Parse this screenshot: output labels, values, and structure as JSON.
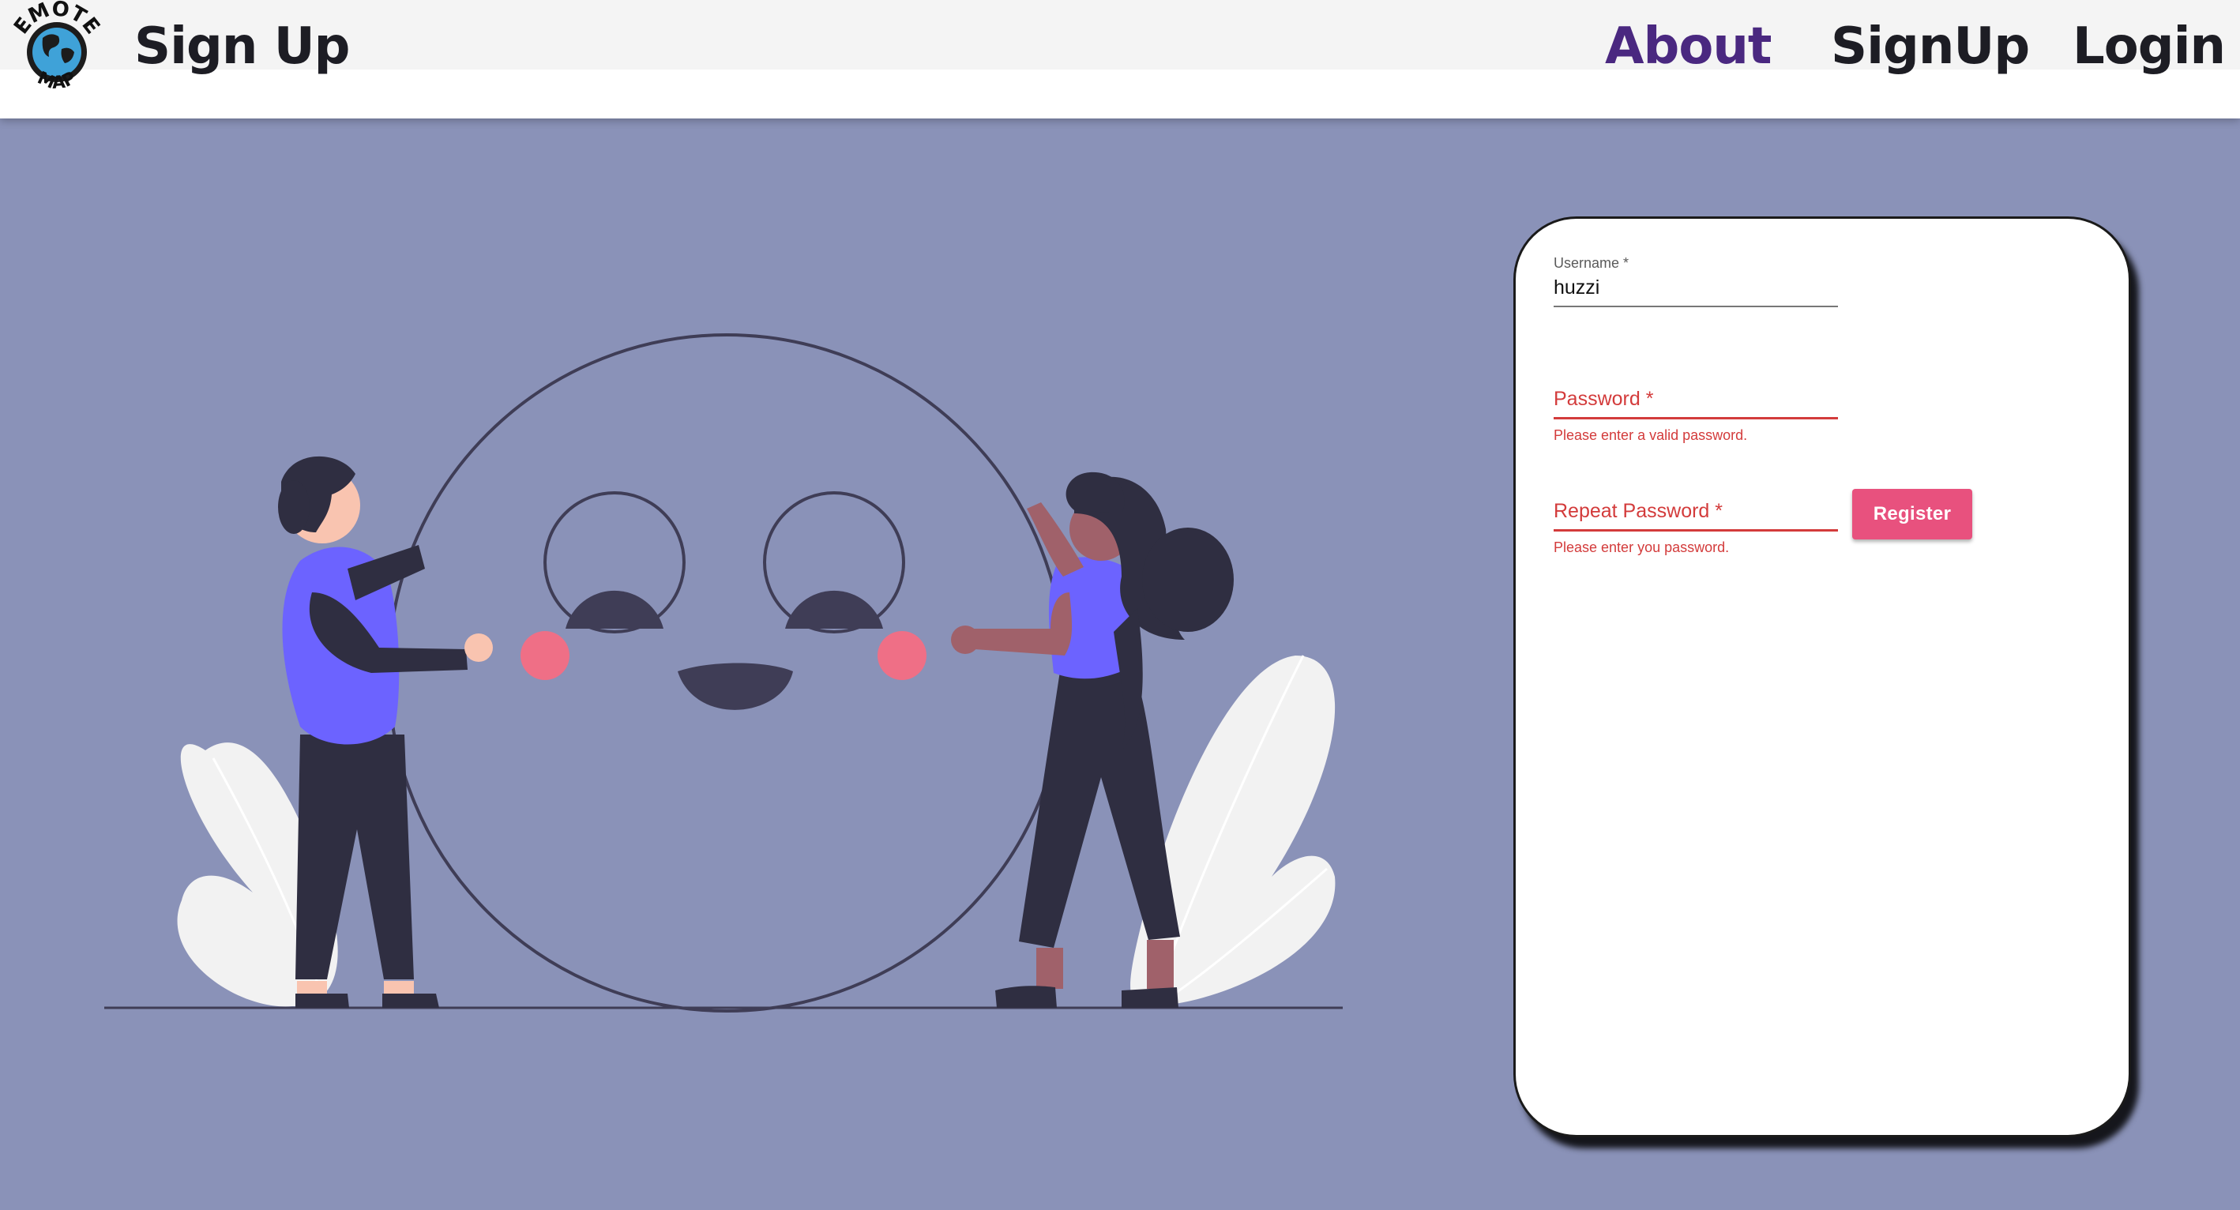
{
  "header": {
    "logo": {
      "top_text": "EMOTE",
      "bottom_text": "MAP",
      "icon": "globe-icon"
    },
    "title": "Sign Up",
    "nav": [
      {
        "label": "About",
        "active": true
      },
      {
        "label": "SignUp",
        "active": false
      },
      {
        "label": "Login",
        "active": false
      }
    ],
    "active_color": "#4a2880"
  },
  "illustration": {
    "description_icon": "friends-holding-smiley-illustration"
  },
  "form": {
    "username": {
      "label": "Username *",
      "value": "huzzi"
    },
    "password": {
      "label": "Password *",
      "value": "",
      "error": "Please enter a valid password."
    },
    "repeat_password": {
      "label": "Repeat Password *",
      "value": "",
      "error": "Please enter you password."
    },
    "register_label": "Register"
  },
  "colors": {
    "background": "#8a92b8",
    "accent": "#e8517e",
    "error": "#d33b3b",
    "shirt": "#6c63ff"
  }
}
